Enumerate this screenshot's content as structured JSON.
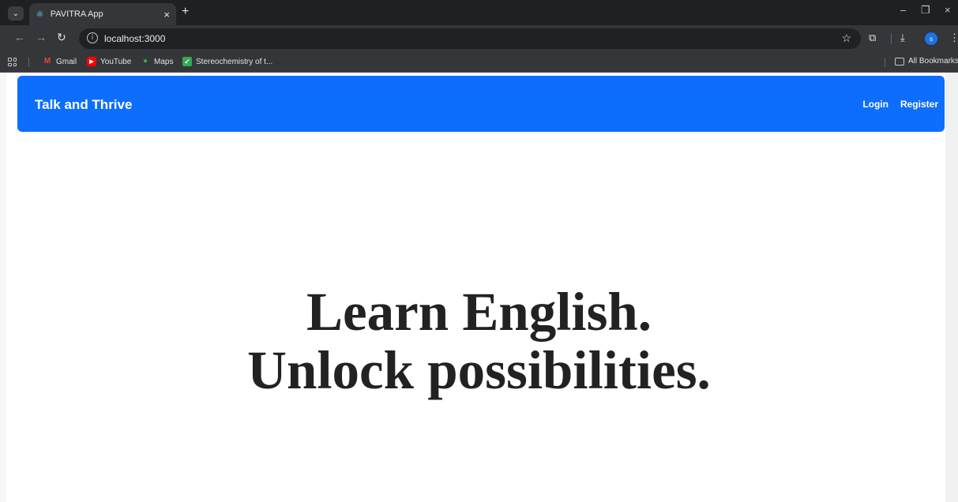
{
  "browser": {
    "tab": {
      "title": "PAVITRA App",
      "favicon": "react-atom-icon",
      "close_symbol": "×"
    },
    "new_tab_symbol": "+",
    "window_controls": {
      "minimize": "–",
      "restore": "❐",
      "close": "×"
    },
    "address_bar": {
      "url": "localhost:3000",
      "info_symbol": "i"
    },
    "profile_initial": "s",
    "bookmarks": [
      {
        "label": "Gmail",
        "icon": "gmail-icon",
        "color": "#ea4335"
      },
      {
        "label": "YouTube",
        "icon": "youtube-icon",
        "color": "#ff0000"
      },
      {
        "label": "Maps",
        "icon": "maps-pin-icon",
        "color": "#34a853"
      },
      {
        "label": "Stereochemistry of t...",
        "icon": "checkbox-icon",
        "color": "#34a853"
      }
    ],
    "all_bookmarks_label": "All Bookmarks"
  },
  "app": {
    "brand": "Talk and Thrive",
    "nav": {
      "login": "Login",
      "register": "Register"
    },
    "hero": {
      "line1": "Learn English.",
      "line2": "Unlock possibilities."
    },
    "colors": {
      "navbar": "#0d6efd",
      "hero_text": "#222222"
    }
  }
}
